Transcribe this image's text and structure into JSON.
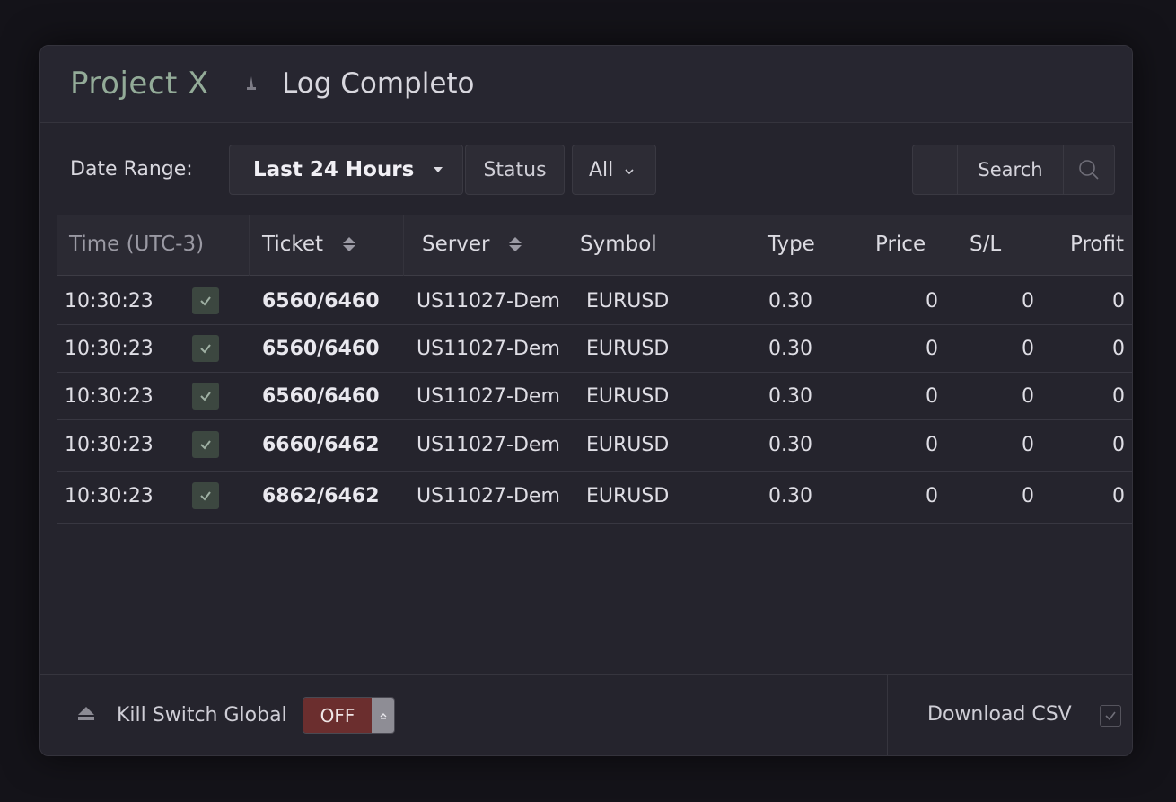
{
  "header": {
    "title": "Project X",
    "subtitle": "Log Completo"
  },
  "filters": {
    "date_range_label": "Date Range:",
    "date_range_value": "Last 24 Hours",
    "status_label": "Status",
    "status_value": "All",
    "search_label": "Search"
  },
  "table": {
    "columns": [
      "Time (UTC-3)",
      "Ticket",
      "Server",
      "Symbol",
      "Type",
      "Price",
      "S/L",
      "Profit"
    ],
    "rows": [
      {
        "time": "10:30:23",
        "checked": true,
        "ticket": "6560/6460",
        "server": "US11027-Dem",
        "symbol": "EURUSD",
        "type": "0.30",
        "price": "0",
        "sl": "0",
        "profit": "0"
      },
      {
        "time": "10:30:23",
        "checked": true,
        "ticket": "6560/6460",
        "server": "US11027-Dem",
        "symbol": "EURUSD",
        "type": "0.30",
        "price": "0",
        "sl": "0",
        "profit": "0"
      },
      {
        "time": "10:30:23",
        "checked": true,
        "ticket": "6560/6460",
        "server": "US11027-Dem",
        "symbol": "EURUSD",
        "type": "0.30",
        "price": "0",
        "sl": "0",
        "profit": "0"
      },
      {
        "time": "10:30:23",
        "checked": true,
        "ticket": "6660/6462",
        "server": "US11027-Dem",
        "symbol": "EURUSD",
        "type": "0.30",
        "price": "0",
        "sl": "0",
        "profit": "0"
      },
      {
        "time": "10:30:23",
        "checked": true,
        "ticket": "6862/6462",
        "server": "US11027-Dem",
        "symbol": "EURUSD",
        "type": "0.30",
        "price": "0",
        "sl": "0",
        "profit": "0"
      }
    ]
  },
  "footer": {
    "kill_switch_label": "Kill Switch Global",
    "kill_switch_state": "OFF",
    "download_label": "Download CSV"
  },
  "icons": {
    "breadcrumb": "separator-icon",
    "date_caret": "caret-down-icon",
    "status_chevron": "chevron-down-icon",
    "search": "search-icon",
    "sort": "sort-icon",
    "row_check": "checkmark-icon",
    "kill_switch": "eject-icon",
    "toggle_knob": "toggle-knob-icon"
  },
  "colors": {
    "accent_title": "#93ab98",
    "kill_switch_off": "#6b2e2e",
    "check_bg": "#3c4740"
  }
}
